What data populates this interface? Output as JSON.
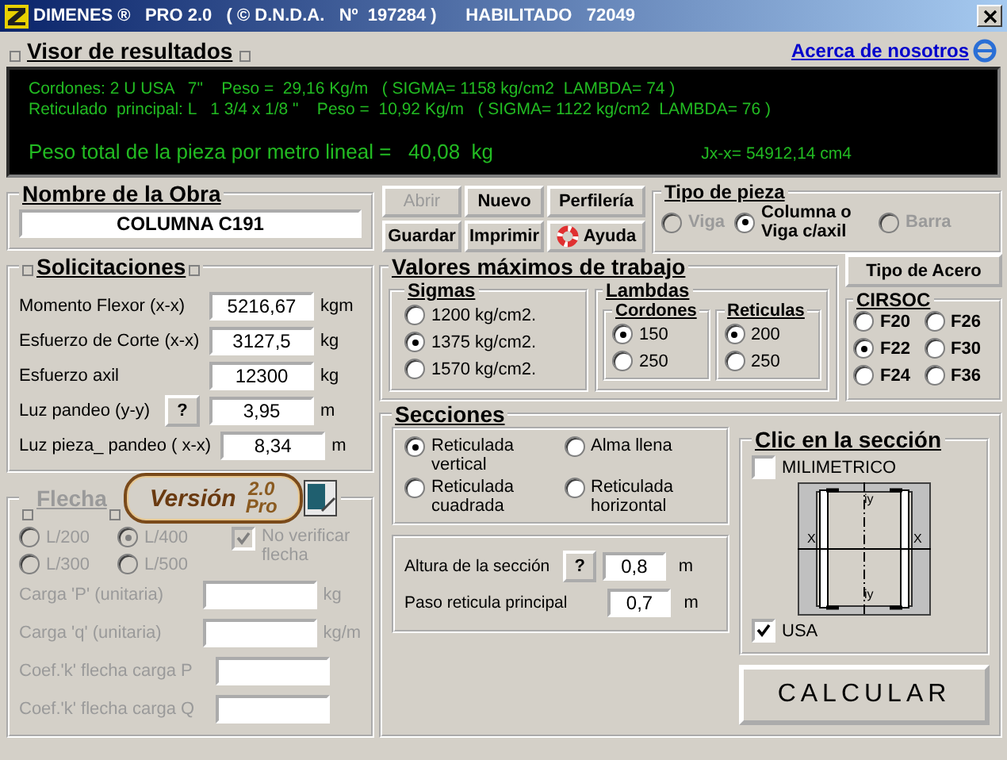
{
  "window": {
    "title": "DIMENES ®   PRO 2.0   ( © D.N.D.A.   Nº  197284 )      HABILITADO   72049"
  },
  "results": {
    "title": "Visor de resultados",
    "about_link": "Acerca de nosotros",
    "lines": [
      "Cordones: 2 U USA   7\"    Peso =  29,16 Kg/m   ( SIGMA= 1158 kg/cm2  LAMBDA= 74 )",
      "Reticulado  principal: L   1 3/4 x 1/8 \"    Peso =  10,92 Kg/m   ( SIGMA= 1122 kg/cm2  LAMBDA= 76 )"
    ],
    "total": "Peso total de la pieza por metro lineal =   40,08  kg",
    "inertia": "Jx-x= 54912,14 cm4"
  },
  "project": {
    "title": "Nombre de la Obra",
    "value": "COLUMNA C191"
  },
  "loads": {
    "title": "Solicitaciones",
    "rows": [
      {
        "label": "Momento Flexor (x-x)",
        "value": "5216,67",
        "unit": "kgm"
      },
      {
        "label": "Esfuerzo de Corte (x-x)",
        "value": "3127,5",
        "unit": "kg"
      },
      {
        "label": "Esfuerzo axil",
        "value": "12300",
        "unit": "kg"
      },
      {
        "label": "Luz pandeo (y-y)",
        "help": "?",
        "value": "3,95",
        "unit": "m"
      },
      {
        "label": "Luz pieza_ pandeo ( x-x)",
        "value": "8,34",
        "unit": "m"
      }
    ]
  },
  "version_badge": {
    "text": "Versión",
    "number": "2.0",
    "edition": "Pro"
  },
  "deflection": {
    "title": "Flecha",
    "disabled": true,
    "options": [
      {
        "label": "L/200",
        "selected": false
      },
      {
        "label": "L/400",
        "selected": true
      },
      {
        "label": "L/300",
        "selected": false
      },
      {
        "label": "L/500",
        "selected": false
      }
    ],
    "no_verify": {
      "label": "No verificar flecha",
      "checked": true
    },
    "fields": [
      {
        "label": "Carga 'P' (unitaria)",
        "unit": "kg"
      },
      {
        "label": "Carga 'q' (unitaria)",
        "unit": "kg/m"
      },
      {
        "label": "Coef.'k' flecha carga P"
      },
      {
        "label": "Coef.'k' flecha carga Q"
      }
    ]
  },
  "toolbar": {
    "buttons": [
      {
        "label": "Abrir",
        "disabled": true
      },
      {
        "label": "Nuevo",
        "disabled": false
      },
      {
        "label": "Perfilería",
        "disabled": false
      },
      {
        "label": "Guardar",
        "disabled": false
      },
      {
        "label": "Imprimir",
        "disabled": false
      },
      {
        "label": "Ayuda",
        "disabled": false,
        "kind": "help"
      }
    ]
  },
  "piece_type": {
    "title": "Tipo de pieza",
    "options": [
      {
        "label": "Viga",
        "selected": false,
        "disabled": true
      },
      {
        "label": "Columna o Viga c/axil",
        "selected": true,
        "disabled": false
      },
      {
        "label": "Barra",
        "selected": false,
        "disabled": true
      }
    ]
  },
  "max_values": {
    "title": "Valores máximos de trabajo",
    "sigmas": {
      "title": "Sigmas",
      "options": [
        {
          "label": "1200 kg/cm2.",
          "selected": false
        },
        {
          "label": "1375 kg/cm2.",
          "selected": true
        },
        {
          "label": "1570 kg/cm2.",
          "selected": false
        }
      ]
    },
    "lambdas": {
      "title": "Lambdas",
      "groups": [
        {
          "title": "Cordones",
          "options": [
            {
              "label": "150",
              "selected": true
            },
            {
              "label": "250",
              "selected": false
            }
          ]
        },
        {
          "title": "Reticulas",
          "options": [
            {
              "label": "200",
              "selected": true
            },
            {
              "label": "250",
              "selected": false
            }
          ]
        }
      ]
    }
  },
  "steel": {
    "button": "Tipo de Acero",
    "title": "CIRSOC",
    "options": [
      {
        "label": "F20",
        "selected": false
      },
      {
        "label": "F26",
        "selected": false
      },
      {
        "label": "F22",
        "selected": true
      },
      {
        "label": "F30",
        "selected": false
      },
      {
        "label": "F24",
        "selected": false
      },
      {
        "label": "F36",
        "selected": false
      }
    ]
  },
  "sections": {
    "title": "Secciones",
    "options": [
      {
        "label": "Reticulada vertical",
        "selected": true
      },
      {
        "label": "Alma llena",
        "selected": false
      },
      {
        "label": "Reticulada cuadrada",
        "selected": false
      },
      {
        "label": "Reticulada horizontal",
        "selected": false
      }
    ],
    "height": {
      "label": "Altura de la sección",
      "help": "?",
      "value": "0,8",
      "unit": "m"
    },
    "step": {
      "label": "Paso reticula principal",
      "value": "0,7",
      "unit": "m"
    }
  },
  "click_section": {
    "title": "Clic en la sección",
    "milimetric": {
      "label": "MILIMETRICO",
      "checked": false
    },
    "axis_labels": [
      "X",
      "X",
      "iy",
      "iy"
    ],
    "usa": {
      "label": "USA",
      "checked": true
    }
  },
  "calculate_button": "CALCULAR"
}
